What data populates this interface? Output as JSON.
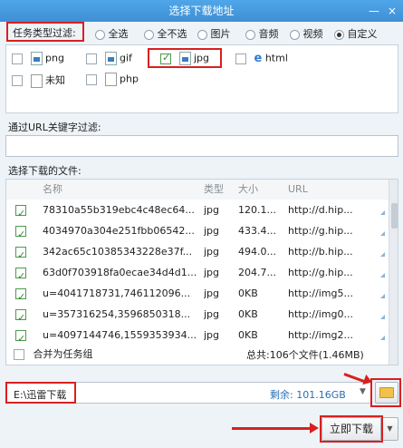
{
  "window": {
    "title": "选择下载地址",
    "minimize_glyph": "—",
    "close_glyph": "×"
  },
  "type_filter": {
    "label": "任务类型过滤:",
    "options": [
      "全选",
      "全不选",
      "图片",
      "音频",
      "视频",
      "自定义"
    ],
    "selected": "自定义",
    "types": [
      {
        "label": "png",
        "checked": false,
        "icon": "image-file-icon"
      },
      {
        "label": "gif",
        "checked": false,
        "icon": "image-file-icon"
      },
      {
        "label": "jpg",
        "checked": true,
        "icon": "image-file-icon"
      },
      {
        "label": "html",
        "checked": false,
        "icon": "ie-browser-icon"
      },
      {
        "label": "未知",
        "checked": false,
        "icon": "text-file-icon"
      },
      {
        "label": "php",
        "checked": false,
        "icon": "blank-file-icon"
      }
    ]
  },
  "url_filter": {
    "label": "通过URL关键字过滤:",
    "value": ""
  },
  "files": {
    "label": "选择下载的文件:",
    "columns": [
      "名称",
      "类型",
      "大小",
      "URL"
    ],
    "rows": [
      {
        "checked": true,
        "name": "78310a55b319ebc4c48ec64...",
        "type": "jpg",
        "size": "120.1...",
        "url": "http://d.hip..."
      },
      {
        "checked": true,
        "name": "4034970a304e251fbb06542...",
        "type": "jpg",
        "size": "433.4...",
        "url": "http://g.hip..."
      },
      {
        "checked": true,
        "name": "342ac65c10385343228e37f...",
        "type": "jpg",
        "size": "494.0...",
        "url": "http://b.hip..."
      },
      {
        "checked": true,
        "name": "63d0f703918fa0ecae34d4d1...",
        "type": "jpg",
        "size": "204.7...",
        "url": "http://g.hip..."
      },
      {
        "checked": true,
        "name": "u=4041718731,746112096...",
        "type": "jpg",
        "size": "0KB",
        "url": "http://img5..."
      },
      {
        "checked": true,
        "name": "u=357316254,3596850318...",
        "type": "jpg",
        "size": "0KB",
        "url": "http://img0..."
      },
      {
        "checked": true,
        "name": "u=4097144746,1559353934...",
        "type": "jpg",
        "size": "0KB",
        "url": "http://img2..."
      }
    ],
    "merge_label": "合并为任务组",
    "merge_checked": false,
    "total": "总共:106个文件(1.46MB)"
  },
  "save": {
    "path": "E:\\迅雷下载",
    "remaining": "剩余: 101.16GB",
    "dropdown_glyph": "▼"
  },
  "actions": {
    "download_label": "立即下载",
    "more_glyph": "▼"
  },
  "colors": {
    "highlight": "#d82020",
    "titlebar": "#3f8fd5",
    "check": "#2e8b2e"
  }
}
